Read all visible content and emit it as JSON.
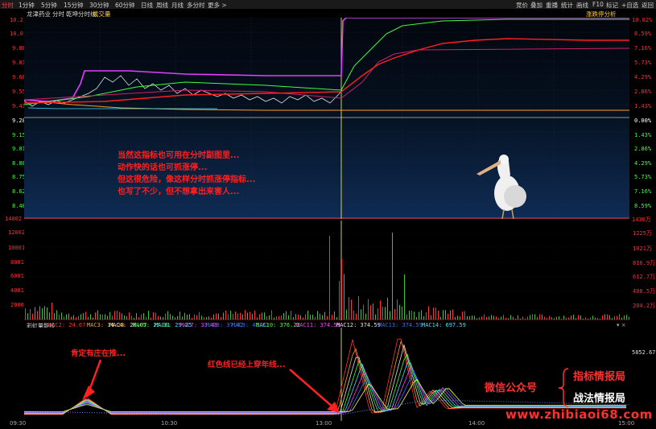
{
  "toolbar": {
    "left_items": [
      "分时",
      "1分钟",
      "5分钟",
      "15分钟",
      "30分钟",
      "60分钟",
      "日线",
      "周线",
      "月线",
      "多分时",
      "更多 >"
    ],
    "right_items": [
      "竞价",
      "叠加",
      "重播",
      "统计",
      "画线",
      "F10",
      "标记",
      "+自选",
      "返回"
    ]
  },
  "title": {
    "stock_name": "龙津药业",
    "tabs": [
      "分时",
      "乾坤分时线",
      "成交量"
    ],
    "right_tag": "涨跌停分析"
  },
  "price_axis": {
    "left": [
      "10.21",
      "10.01",
      "9.88",
      "9.81",
      "9.68",
      "9.55",
      "9.41",
      "9.28",
      "9.15",
      "9.01",
      "8.88",
      "8.75",
      "8.62",
      "8.48",
      "14002"
    ],
    "right": [
      "10.02%",
      "8.59%",
      "7.16%",
      "5.73%",
      "4.29%",
      "2.86%",
      "1.43%",
      "0.00%",
      "1.43%",
      "2.86%",
      "4.29%",
      "5.73%",
      "7.16%",
      "8.59%",
      "1430万"
    ]
  },
  "volume_axis": {
    "left": [
      "12002",
      "10001",
      "8001",
      "6001",
      "4001",
      "2000"
    ],
    "right": [
      "1225万",
      "1021万",
      "816.9万",
      "612.7万",
      "408.5万",
      "204.2万"
    ]
  },
  "indicator": {
    "name": "彩虹量能线",
    "right_value": "5852.67",
    "values": [
      {
        "text": "MAC2: 24.67",
        "color": "#ff3030"
      },
      {
        "text": "MAC3: 14.23",
        "color": "#ffa020"
      },
      {
        "text": "MAC4: 20.07",
        "color": "#e0e0e0"
      },
      {
        "text": "MAC5: 25.01",
        "color": "#40ff40"
      },
      {
        "text": "MAC6: 29.25",
        "color": "#40e0ff"
      },
      {
        "text": "MAC7: 33.48",
        "color": "#ff40ff"
      },
      {
        "text": "MAC8: 37.42",
        "color": "#3070ff"
      },
      {
        "text": "MAC9: 41.82",
        "color": "#3070ff"
      },
      {
        "text": "MAC10: 376.22",
        "color": "#40ff40"
      },
      {
        "text": "MAC11: 374.59",
        "color": "#ff40ff"
      },
      {
        "text": "MAC12: 374.59",
        "color": "#e0e0e0"
      },
      {
        "text": "MAC13: 374.59",
        "color": "#3070ff"
      },
      {
        "text": "MAC14: 697.59",
        "color": "#40e0ff"
      }
    ]
  },
  "annotations": {
    "main_note": [
      "当然这指标也可用在分时副图里...",
      "动作快的话也可抓涨停...",
      "但这很危险，像这样分时抓涨停指标...",
      "也写了不少，但不想拿出来害人..."
    ],
    "note_left": "肯定有庄在推...",
    "note_right": "红色线已经上穿年线..."
  },
  "watermark": {
    "wechat": "微信公众号",
    "brand1": "指标情报局",
    "brand2": "战法情报局",
    "url": "www.zhibiaoi68.com"
  },
  "x_axis": [
    "09:30",
    "10:30",
    "13:00",
    "14:00",
    "15:00"
  ],
  "colors": {
    "up": "#ff3030",
    "price_line": "#e040ff",
    "avg_line": "#ffff00",
    "axis_red": "#ff3030"
  }
}
